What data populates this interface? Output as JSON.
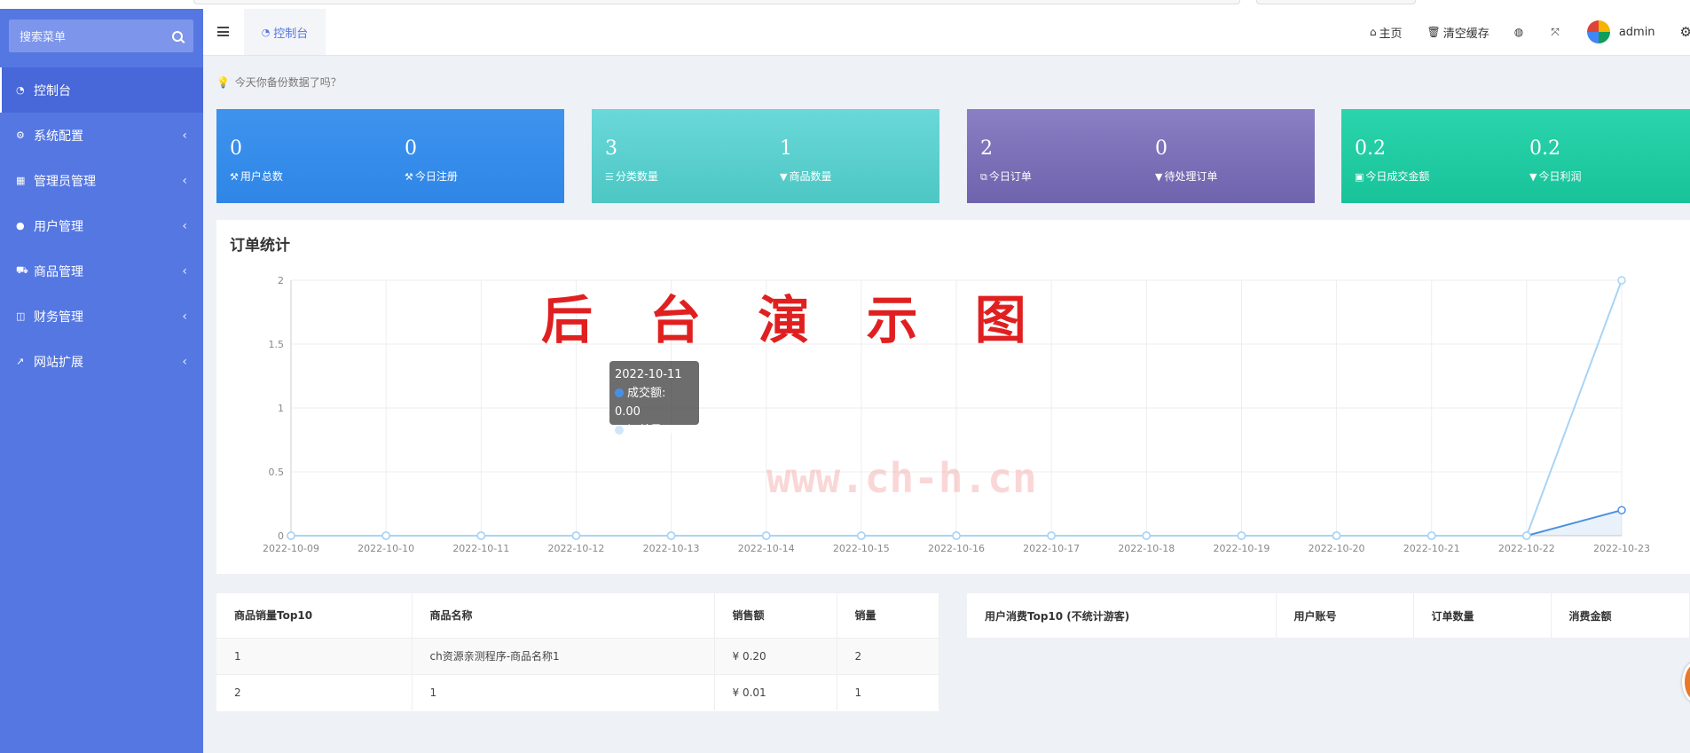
{
  "sidebar": {
    "search_placeholder": "搜索菜单",
    "items": [
      {
        "label": "控制台",
        "icon": "dashboard-icon",
        "active": true
      },
      {
        "label": "系统配置",
        "icon": "cogs-icon"
      },
      {
        "label": "管理员管理",
        "icon": "windows-icon"
      },
      {
        "label": "用户管理",
        "icon": "user-icon"
      },
      {
        "label": "商品管理",
        "icon": "cart-icon"
      },
      {
        "label": "财务管理",
        "icon": "columns-icon"
      },
      {
        "label": "网站扩展",
        "icon": "external-link-icon"
      }
    ]
  },
  "navbar": {
    "tab_label": "控制台",
    "home_label": "主页",
    "clear_cache_label": "清空缓存",
    "user_name": "admin"
  },
  "tip": "今天你备份数据了吗？",
  "stats": [
    {
      "a_value": "0",
      "a_label": "用户总数",
      "b_value": "0",
      "b_label": "今日注册",
      "color": "#3a8ee6"
    },
    {
      "a_value": "3",
      "a_label": "分类数量",
      "b_value": "1",
      "b_label": "商品数量",
      "color": "#5bcfcf"
    },
    {
      "a_value": "2",
      "a_label": "今日订单",
      "b_value": "0",
      "b_label": "待处理订单",
      "color": "#7b70b8"
    },
    {
      "a_value": "0.2",
      "a_label": "今日成交金额",
      "b_value": "0.2",
      "b_label": "今日利润",
      "color": "#22cca4"
    }
  ],
  "chart": {
    "title": "订单统计",
    "watermark": "后 台 演 示 图",
    "watermark_url": "www.ch-h.cn",
    "tooltip": {
      "date": "2022-10-11",
      "line1": "成交额: 0.00",
      "line2": "订单量: 0"
    }
  },
  "chart_data": {
    "type": "line",
    "x": [
      "2022-10-09",
      "2022-10-10",
      "2022-10-11",
      "2022-10-12",
      "2022-10-13",
      "2022-10-14",
      "2022-10-15",
      "2022-10-16",
      "2022-10-17",
      "2022-10-18",
      "2022-10-19",
      "2022-10-20",
      "2022-10-21",
      "2022-10-22",
      "2022-10-23"
    ],
    "series": [
      {
        "name": "成交额",
        "values": [
          0,
          0,
          0,
          0,
          0,
          0,
          0,
          0,
          0,
          0,
          0,
          0,
          0,
          0,
          0.2
        ],
        "color": "#4a90e2",
        "area": true
      },
      {
        "name": "订单量",
        "values": [
          0,
          0,
          0,
          0,
          0,
          0,
          0,
          0,
          0,
          0,
          0,
          0,
          0,
          0,
          2
        ],
        "color": "#a9d4f5",
        "area": false
      }
    ],
    "ylim": [
      0,
      2
    ],
    "yticks": [
      "0",
      "0.5",
      "1",
      "1.5",
      "2"
    ],
    "grid": true
  },
  "top_products": {
    "headers": [
      "商品销量Top10",
      "商品名称",
      "销售额",
      "销量"
    ],
    "rows": [
      [
        "1",
        "ch资源亲测程序-商品名称1",
        "¥ 0.20",
        "2"
      ],
      [
        "2",
        "1",
        "¥ 0.01",
        "1"
      ]
    ]
  },
  "top_users": {
    "headers": [
      "用户消费Top10 (不统计游客)",
      "用户账号",
      "订单数量",
      "消费金额"
    ],
    "rows": []
  }
}
